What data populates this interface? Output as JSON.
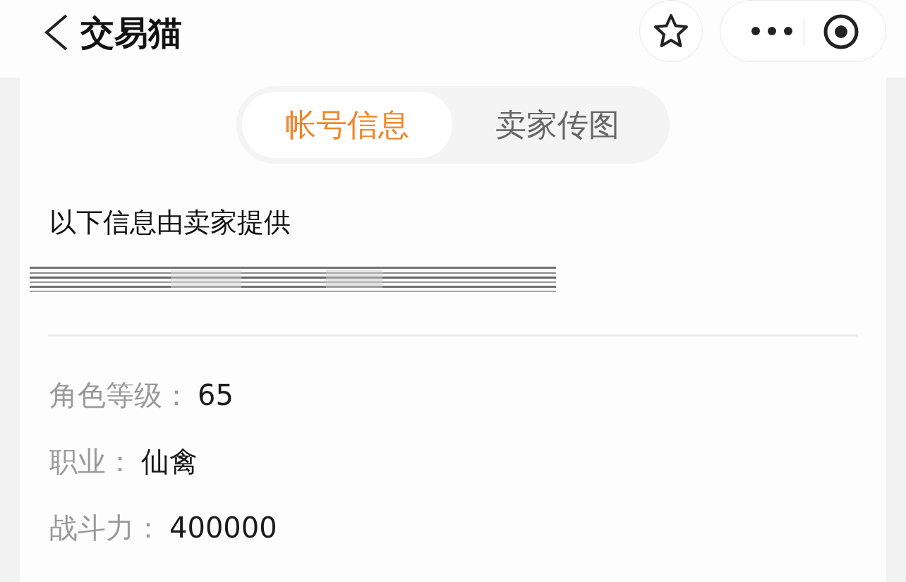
{
  "header": {
    "title": "交易猫"
  },
  "tabs": [
    {
      "label": "帐号信息",
      "selected": true
    },
    {
      "label": "卖家传图",
      "selected": false
    }
  ],
  "notice": "以下信息由卖家提供",
  "fields": [
    {
      "label": "角色等级：",
      "value": "65"
    },
    {
      "label": "职业：",
      "value": "仙禽"
    },
    {
      "label": "战斗力：",
      "value": "400000"
    }
  ]
}
